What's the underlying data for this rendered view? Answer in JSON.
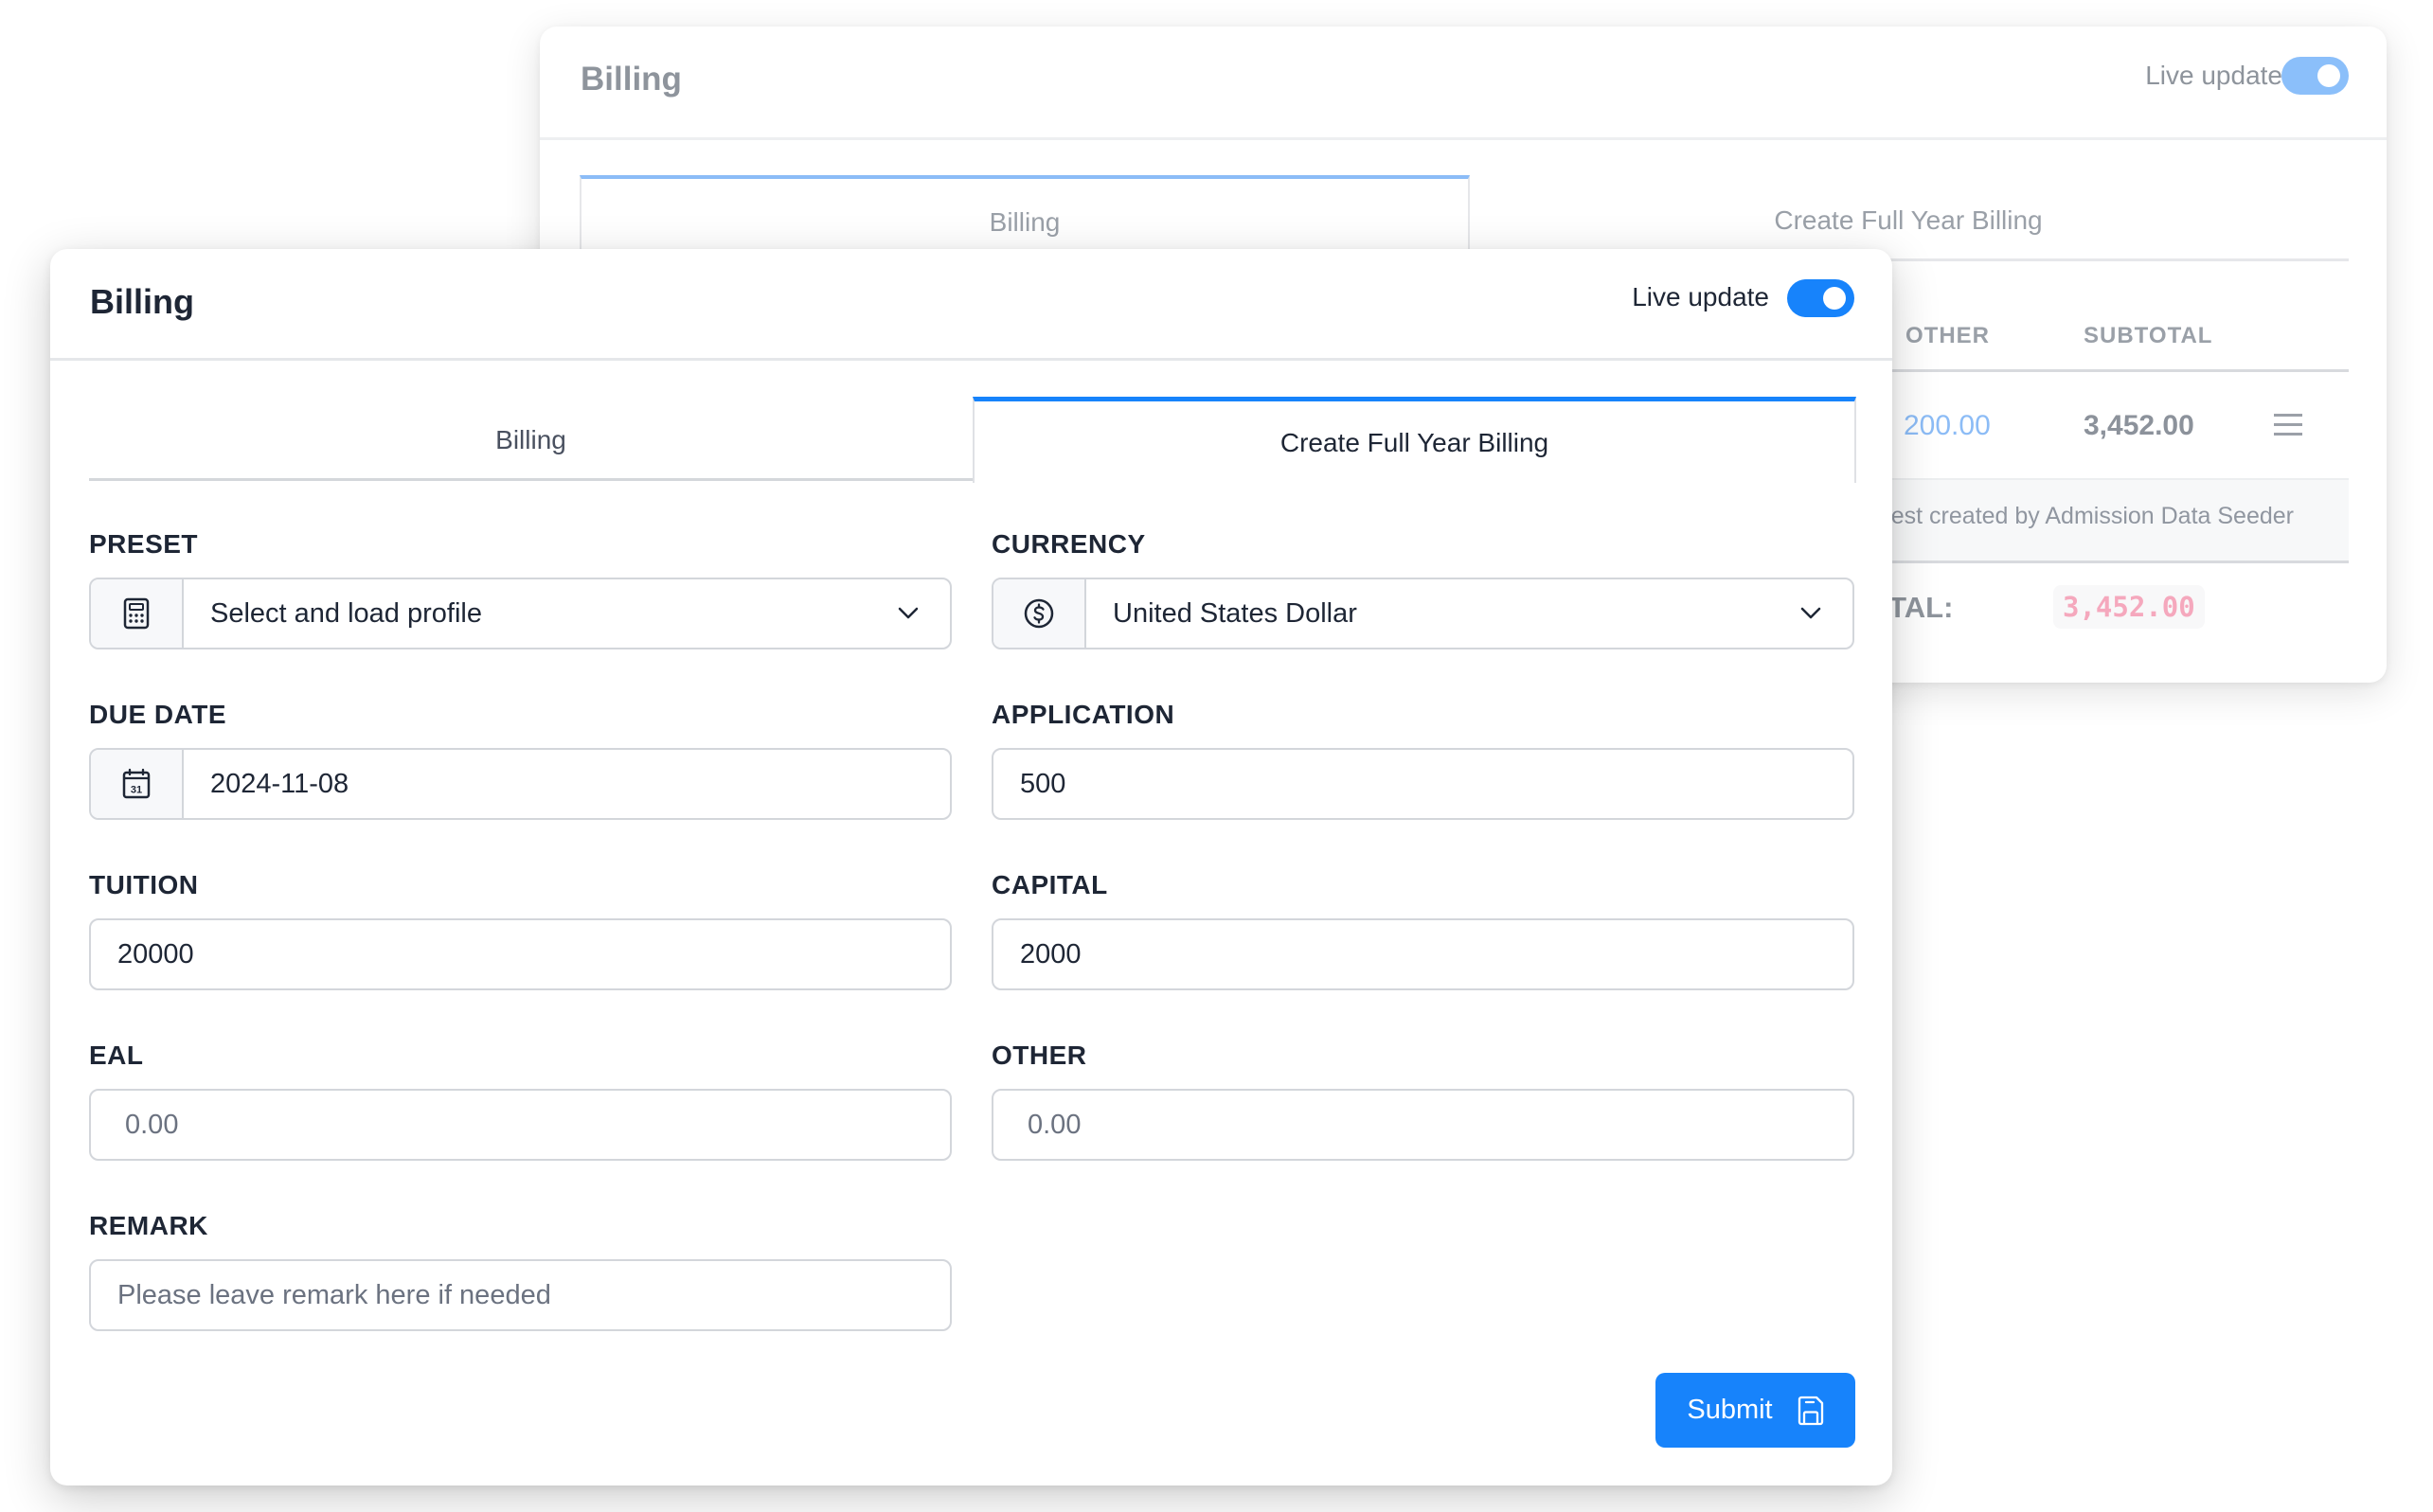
{
  "back_panel": {
    "title": "Billing",
    "live_update_label": "Live update",
    "live_update_on": true,
    "tabs": [
      {
        "label": "Billing",
        "active": true
      },
      {
        "label": "Create Full Year Billing",
        "active": false
      }
    ],
    "table": {
      "columns": [
        "OTHER",
        "SUBTOTAL"
      ],
      "row": {
        "other": "200.00",
        "subtotal": "3,452.00"
      },
      "remark": "est created by Admission Data Seeder",
      "total_label": "OTAL:",
      "total_value": "3,452.00"
    }
  },
  "front_panel": {
    "title": "Billing",
    "live_update_label": "Live update",
    "live_update_on": true,
    "tabs": [
      {
        "label": "Billing",
        "active": false
      },
      {
        "label": "Create Full Year Billing",
        "active": true
      }
    ],
    "form": {
      "preset": {
        "label": "PRESET",
        "value": "Select and load profile",
        "icon": "calculator-icon"
      },
      "currency": {
        "label": "CURRENCY",
        "value": "United States Dollar",
        "icon": "dollar-circle-icon"
      },
      "due_date": {
        "label": "DUE DATE",
        "value": "2024-11-08",
        "icon": "calendar-icon"
      },
      "application": {
        "label": "APPLICATION",
        "value": "500"
      },
      "tuition": {
        "label": "TUITION",
        "value": "20000"
      },
      "capital": {
        "label": "CAPITAL",
        "value": "2000"
      },
      "eal": {
        "label": "EAL",
        "value": "",
        "placeholder": "0.00"
      },
      "other": {
        "label": "OTHER",
        "value": "",
        "placeholder": "0.00"
      },
      "remark": {
        "label": "REMARK",
        "value": "",
        "placeholder": "Please leave remark here if needed"
      }
    },
    "submit_label": "Submit",
    "submit_icon": "save-icon"
  },
  "colors": {
    "accent": "#1783fb",
    "accent_faded": "#8bbffa",
    "total_pink": "#f5a8bd",
    "text_dark": "#1e2635"
  }
}
